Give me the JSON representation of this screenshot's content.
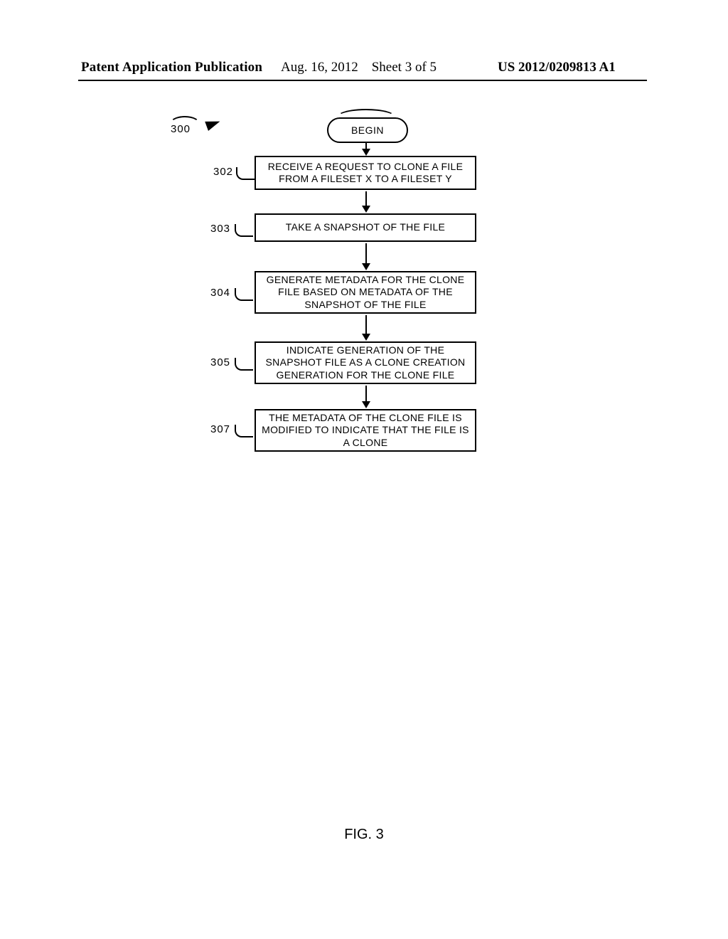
{
  "header": {
    "left": "Patent Application Publication",
    "mid_date": "Aug. 16, 2012",
    "mid_sheet": "Sheet 3 of 5",
    "right": "US 2012/0209813 A1"
  },
  "diagram": {
    "fig_ref": "300",
    "begin": "BEGIN",
    "steps": [
      {
        "ref": "302",
        "text": "RECEIVE A REQUEST TO CLONE A FILE FROM A FILESET X TO A FILESET Y"
      },
      {
        "ref": "303",
        "text": "TAKE A SNAPSHOT OF THE FILE"
      },
      {
        "ref": "304",
        "text": "GENERATE METADATA FOR THE CLONE FILE BASED ON METADATA OF THE SNAPSHOT OF THE FILE"
      },
      {
        "ref": "305",
        "text": "INDICATE GENERATION OF THE SNAPSHOT FILE AS A CLONE CREATION GENERATION FOR THE CLONE FILE"
      },
      {
        "ref": "307",
        "text": "THE METADATA OF THE CLONE FILE IS MODIFIED TO INDICATE THAT THE FILE IS A CLONE"
      }
    ]
  },
  "figure_caption": "FIG. 3"
}
